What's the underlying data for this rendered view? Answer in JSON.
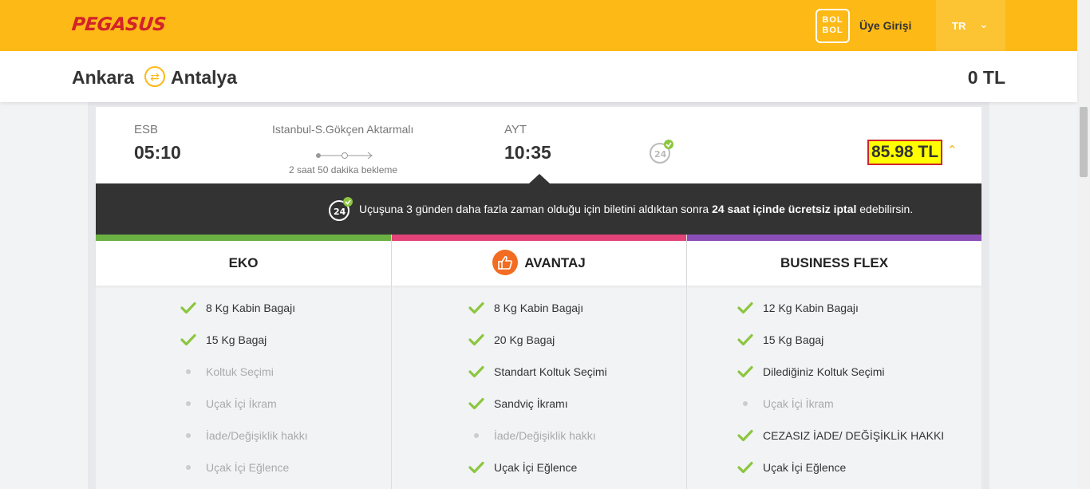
{
  "header": {
    "logo": "PEGASUS",
    "bolbol_line1": "BOL",
    "bolbol_line2": "BOL",
    "login": "Üye Girişi",
    "lang": "TR"
  },
  "route": {
    "from": "Ankara",
    "to": "Antalya",
    "total": "0 TL"
  },
  "flight": {
    "dep_code": "ESB",
    "dep_time": "05:10",
    "transfer": "Istanbul-S.Gökçen Aktarmalı",
    "wait": "2 saat 50 dakika bekleme",
    "arr_code": "AYT",
    "arr_time": "10:35",
    "price": "85.98 TL"
  },
  "notice": {
    "pre": "Uçuşuna 3 günden daha fazla zaman olduğu için biletini aldıktan sonra ",
    "bold": "24 saat içinde ücretsiz iptal",
    "post": " edebilirsin."
  },
  "packages": {
    "eko": {
      "name": "EKO",
      "features": [
        {
          "label": "8 Kg Kabin Bagajı",
          "included": true
        },
        {
          "label": "15 Kg Bagaj",
          "included": true
        },
        {
          "label": "Koltuk Seçimi",
          "included": false
        },
        {
          "label": "Uçak İçi İkram",
          "included": false
        },
        {
          "label": "İade/Değişiklik hakkı",
          "included": false
        },
        {
          "label": "Uçak İçi Eğlence",
          "included": false
        }
      ]
    },
    "avantaj": {
      "name": "AVANTAJ",
      "features": [
        {
          "label": "8 Kg Kabin Bagajı",
          "included": true
        },
        {
          "label": "20 Kg Bagaj",
          "included": true
        },
        {
          "label": "Standart Koltuk Seçimi",
          "included": true
        },
        {
          "label": "Sandviç İkramı",
          "included": true
        },
        {
          "label": "İade/Değişiklik hakkı",
          "included": false
        },
        {
          "label": "Uçak İçi Eğlence",
          "included": true
        }
      ]
    },
    "business": {
      "name": "BUSINESS FLEX",
      "features": [
        {
          "label": "12 Kg Kabin Bagajı",
          "included": true
        },
        {
          "label": "15 Kg Bagaj",
          "included": true
        },
        {
          "label": "Dilediğiniz Koltuk Seçimi",
          "included": true
        },
        {
          "label": "Uçak İçi İkram",
          "included": false
        },
        {
          "label": "CEZASIZ İADE/ DEĞİŞİKLİK HAKKI",
          "included": true
        },
        {
          "label": "Uçak İçi Eğlence",
          "included": true
        }
      ]
    }
  },
  "colors": {
    "brand": "#fdb915",
    "eko": "#6ab043",
    "avantaj": "#e2447a",
    "business": "#8b4fb8",
    "check": "#8cc63f"
  }
}
